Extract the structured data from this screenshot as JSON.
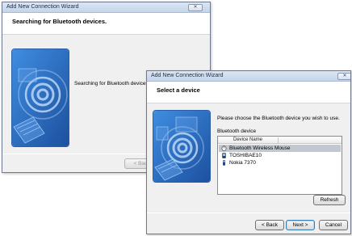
{
  "window_back": {
    "title": "Add New Connection Wizard",
    "close_glyph": "✕",
    "header": "Searching for Bluetooth devices.",
    "status": "Searching for Bluetooth devices.",
    "buttons": {
      "back": "< Back"
    }
  },
  "window_front": {
    "title": "Add New Connection Wizard",
    "close_glyph": "✕",
    "header": "Select a device",
    "instruction": "Please choose the Bluetooth device you wish to use.",
    "group_label": "Bluetooth device",
    "column_header": "Device Name",
    "devices": [
      {
        "name": "Bluetooth Wireless Mouse",
        "icon": "mouse-icon",
        "selected": true
      },
      {
        "name": "TOSHIBAE10",
        "icon": "pda-icon",
        "selected": false
      },
      {
        "name": "Nokia 7370",
        "icon": "phone-icon",
        "selected": false
      }
    ],
    "buttons": {
      "refresh": "Refresh",
      "back": "< Back",
      "next": "Next >",
      "cancel": "Cancel"
    }
  },
  "colors": {
    "art_dark": "#1c4f9e",
    "art_light": "#3f8de0",
    "selection": "#c2c8d0"
  }
}
